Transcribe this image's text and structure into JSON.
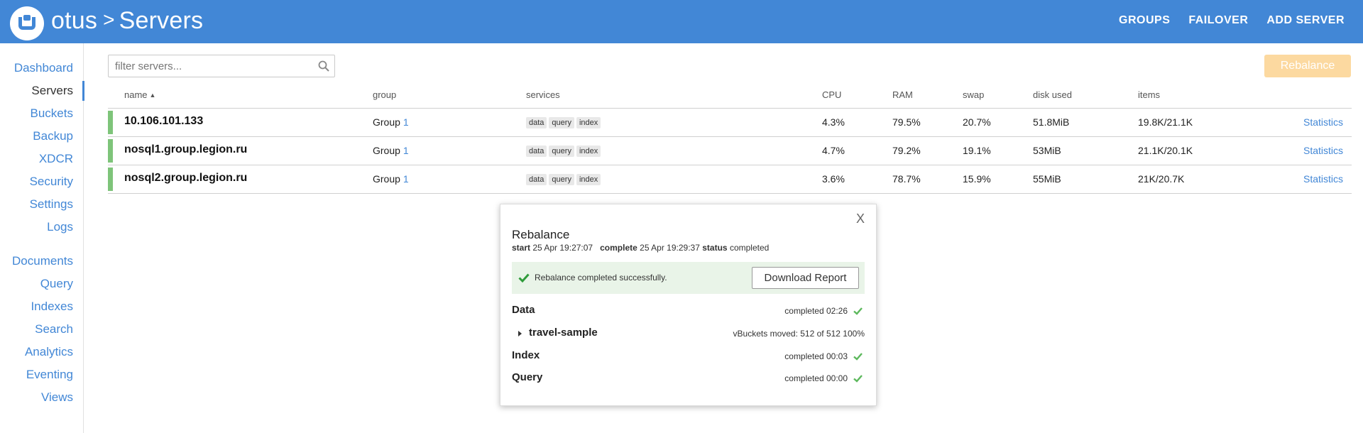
{
  "header": {
    "cluster_name": "otus",
    "separator": ">",
    "page_title": "Servers",
    "nav": [
      "GROUPS",
      "FAILOVER",
      "ADD SERVER"
    ]
  },
  "sidebar": {
    "active": "Servers",
    "items": [
      {
        "label": "Dashboard"
      },
      {
        "label": "Servers"
      },
      {
        "label": "Buckets"
      },
      {
        "label": "Backup"
      },
      {
        "label": "XDCR"
      },
      {
        "label": "Security"
      },
      {
        "label": "Settings"
      },
      {
        "label": "Logs"
      },
      {
        "label": "Documents"
      },
      {
        "label": "Query"
      },
      {
        "label": "Indexes"
      },
      {
        "label": "Search"
      },
      {
        "label": "Analytics"
      },
      {
        "label": "Eventing"
      },
      {
        "label": "Views"
      }
    ]
  },
  "filter": {
    "placeholder": "filter servers..."
  },
  "toolbar": {
    "rebalance_label": "Rebalance"
  },
  "table": {
    "columns": [
      "name",
      "group",
      "services",
      "CPU",
      "RAM",
      "swap",
      "disk used",
      "items"
    ],
    "sort_indicator": "▲",
    "rows": [
      {
        "name": "10.106.101.133",
        "group_prefix": "Group ",
        "group_num": "1",
        "services": [
          "data",
          "query",
          "index"
        ],
        "cpu": "4.3%",
        "ram": "79.5%",
        "swap": "20.7%",
        "disk": "51.8MiB",
        "items": "19.8K/21.1K",
        "link": "Statistics"
      },
      {
        "name": "nosql1.group.legion.ru",
        "group_prefix": "Group ",
        "group_num": "1",
        "services": [
          "data",
          "query",
          "index"
        ],
        "cpu": "4.7%",
        "ram": "79.2%",
        "swap": "19.1%",
        "disk": "53MiB",
        "items": "21.1K/20.1K",
        "link": "Statistics"
      },
      {
        "name": "nosql2.group.legion.ru",
        "group_prefix": "Group ",
        "group_num": "1",
        "services": [
          "data",
          "query",
          "index"
        ],
        "cpu": "3.6%",
        "ram": "78.7%",
        "swap": "15.9%",
        "disk": "55MiB",
        "items": "21K/20.7K",
        "link": "Statistics"
      }
    ]
  },
  "dialog": {
    "close": "X",
    "title": "Rebalance",
    "start_label": "start",
    "start_value": "25 Apr 19:27:07",
    "complete_label": "complete",
    "complete_value": "25 Apr 19:29:37",
    "status_label": "status",
    "status_value": "completed",
    "success_message": "Rebalance completed successfully.",
    "download_label": "Download Report",
    "sections": [
      {
        "label": "Data",
        "status": "completed 02:26"
      },
      {
        "label": "travel-sample",
        "status": "vBuckets moved: 512 of 512   100%"
      },
      {
        "label": "Index",
        "status": "completed 00:03"
      },
      {
        "label": "Query",
        "status": "completed 00:00"
      }
    ]
  },
  "colors": {
    "brand": "#4287d6",
    "healthy": "#7ec47a",
    "rebalance_disabled": "#fcd9a0",
    "success_bg": "#e9f4e8"
  }
}
